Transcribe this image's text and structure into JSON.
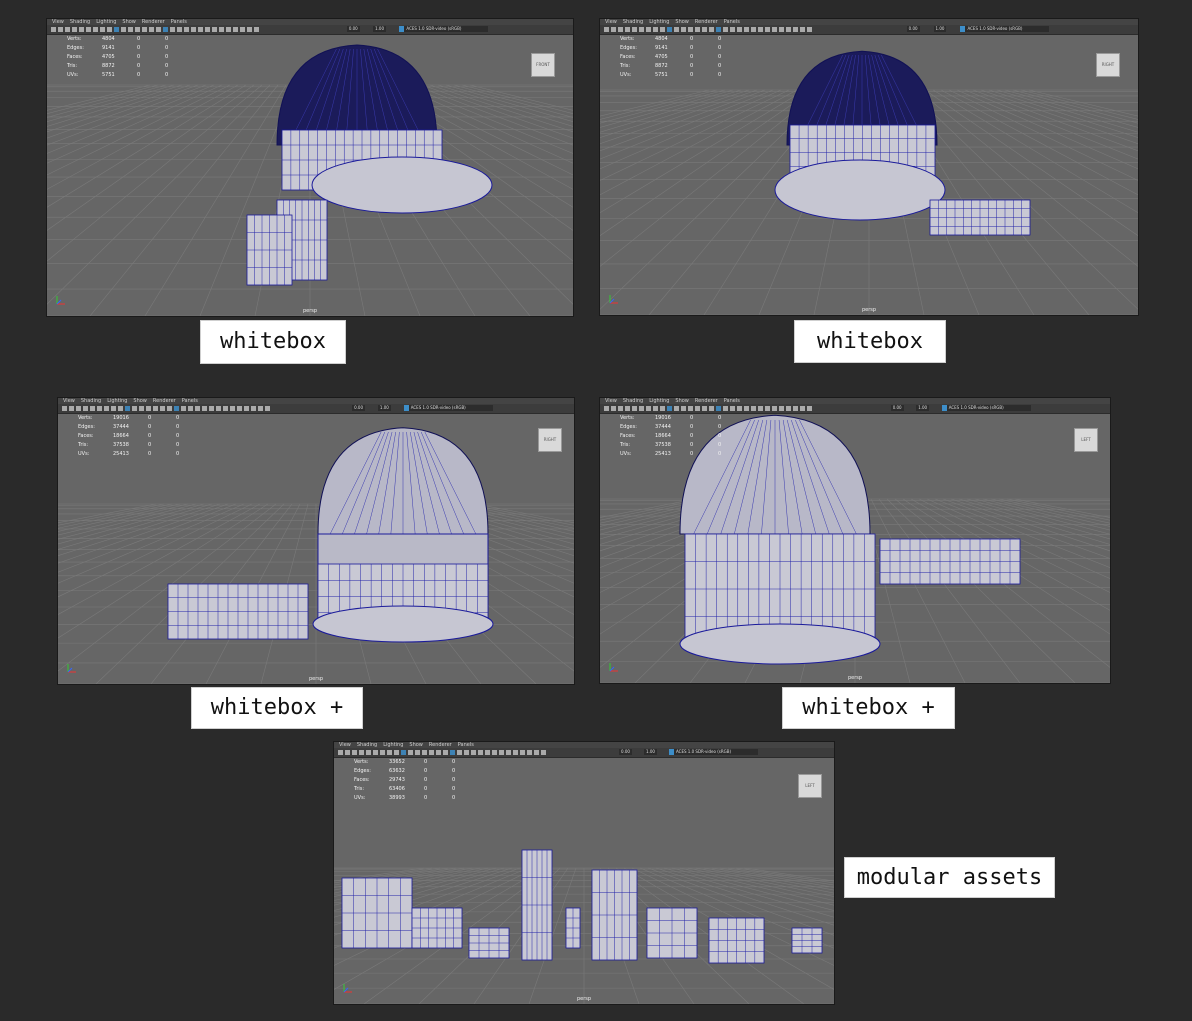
{
  "menu_items": [
    "View",
    "Shading",
    "Lighting",
    "Show",
    "Renderer",
    "Panels"
  ],
  "panels": [
    {
      "hud": {
        "verts": "4804",
        "edges": "9141",
        "faces": "4705",
        "tris": "8872",
        "uvs": "5751"
      },
      "field1": "0.00",
      "field2": "1.00",
      "colorspace": "ACES 1.0 SDR-video (sRGB)",
      "camera": "persp",
      "cube": "FRONT",
      "label": "whitebox"
    },
    {
      "hud": {
        "verts": "4804",
        "edges": "9141",
        "faces": "4705",
        "tris": "8872",
        "uvs": "5751"
      },
      "field1": "0.00",
      "field2": "1.00",
      "colorspace": "ACES 1.0 SDR-video (sRGB)",
      "camera": "persp",
      "cube": "RIGHT",
      "label": "whitebox"
    },
    {
      "hud": {
        "verts": "19016",
        "edges": "37444",
        "faces": "18664",
        "tris": "37538",
        "uvs": "25413"
      },
      "field1": "0.00",
      "field2": "1.00",
      "colorspace": "ACES 1.0 SDR-video (sRGB)",
      "camera": "persp",
      "cube": "RIGHT",
      "label": "whitebox +"
    },
    {
      "hud": {
        "verts": "19016",
        "edges": "37444",
        "faces": "18664",
        "tris": "37538",
        "uvs": "25413"
      },
      "field1": "0.00",
      "field2": "1.00",
      "colorspace": "ACES 1.0 SDR-video (sRGB)",
      "camera": "persp",
      "cube": "LEFT",
      "label": "whitebox +"
    },
    {
      "hud": {
        "verts": "33652",
        "edges": "63632",
        "faces": "29743",
        "tris": "63406",
        "uvs": "38993"
      },
      "field1": "0.00",
      "field2": "1.00",
      "colorspace": "ACES 1.0 SDR-video (sRGB)",
      "camera": "persp",
      "cube": "LEFT",
      "label": "modular assets"
    }
  ],
  "hud_labels": {
    "verts": "Verts:",
    "edges": "Edges:",
    "faces": "Faces:",
    "tris": "Tris:",
    "uvs": "UVs:"
  },
  "hud_zero": "0"
}
